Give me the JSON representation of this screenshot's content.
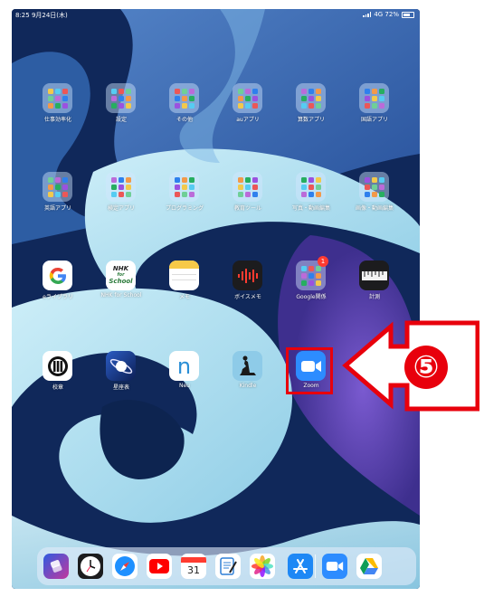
{
  "status_bar": {
    "time_date": "8:25  9月24日(木)",
    "right": "4G 72%"
  },
  "rows": [
    [
      {
        "label": "仕事効率化",
        "kind": "folder"
      },
      {
        "label": "設定",
        "kind": "folder"
      },
      {
        "label": "その他",
        "kind": "folder"
      },
      {
        "label": "auアプリ",
        "kind": "folder"
      },
      {
        "label": "算数アプリ",
        "kind": "folder"
      },
      {
        "label": "国語アプリ",
        "kind": "folder"
      }
    ],
    [
      {
        "label": "英語アプリ",
        "kind": "folder"
      },
      {
        "label": "検定アプリ",
        "kind": "folder"
      },
      {
        "label": "プログラミング",
        "kind": "folder"
      },
      {
        "label": "教育ツール",
        "kind": "folder"
      },
      {
        "label": "写真・動画編集",
        "kind": "folder"
      },
      {
        "label": "画像・動画編集",
        "kind": "folder"
      }
    ],
    [
      {
        "label": "eライブラリ",
        "kind": "google"
      },
      {
        "label": "NHK for School",
        "kind": "nhk",
        "icon_text_1": "NHK",
        "icon_text_2": "for",
        "icon_text_3": "School"
      },
      {
        "label": "メモ",
        "kind": "notes"
      },
      {
        "label": "ボイスメモ",
        "kind": "voicememo"
      },
      {
        "label": "Google関係",
        "kind": "folder",
        "badge": "1"
      },
      {
        "label": "計測",
        "kind": "measure"
      }
    ],
    [
      {
        "label": "校章",
        "kind": "crest"
      },
      {
        "label": "星座表",
        "kind": "stars"
      },
      {
        "label": "Neu",
        "kind": "neu",
        "icon_text": "n"
      },
      {
        "label": "Kindle",
        "kind": "kindle"
      },
      {
        "label": "Zoom",
        "kind": "zoom"
      }
    ]
  ],
  "dock": [
    {
      "name": "shortcuts"
    },
    {
      "name": "clock"
    },
    {
      "name": "safari"
    },
    {
      "name": "youtube"
    },
    {
      "name": "calendar",
      "text": "31"
    },
    {
      "name": "goodnotes"
    },
    {
      "name": "photos"
    },
    {
      "name": "app-store"
    },
    {
      "name": "zoom"
    },
    {
      "name": "google-drive"
    }
  ],
  "annotation": {
    "step": "⑤",
    "color": "#e8000c"
  },
  "colors": {
    "wallpaper_dark": "#0f2a58",
    "wallpaper_light": "#a9dcee",
    "accent_purple": "#5a3ca8"
  }
}
